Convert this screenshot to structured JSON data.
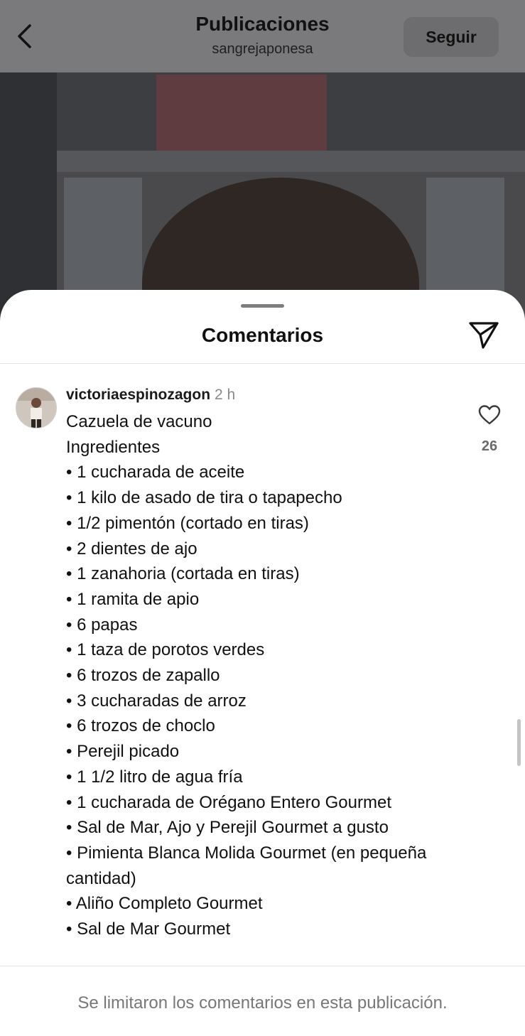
{
  "header": {
    "title": "Publicaciones",
    "username": "sangrejaponesa",
    "follow_label": "Seguir",
    "back_icon": "chevron-left-icon"
  },
  "sheet": {
    "title": "Comentarios",
    "share_icon": "paper-plane-icon"
  },
  "comment": {
    "author": "victoriaespinozagon",
    "time": "2 h",
    "likes": "26",
    "lines": [
      "Cazuela de vacuno",
      "Ingredientes",
      "• 1 cucharada de aceite",
      "• 1 kilo de asado de tira o tapapecho",
      "• 1/2 pimentón (cortado en tiras)",
      "• 2 dientes de ajo",
      "• 1 zanahoria (cortada en tiras)",
      "• 1 ramita de apio",
      "• 6 papas",
      "• 1 taza de porotos verdes",
      "• 6 trozos de zapallo",
      "• 3 cucharadas de arroz",
      "• 6 trozos de choclo",
      "• Perejil picado",
      "• 1 1/2 litro de agua fría",
      "• 1 cucharada de Orégano Entero Gourmet",
      "• Sal de Mar, Ajo y Perejil Gourmet a gusto",
      "• Pimienta Blanca Molida Gourmet (en pequeña",
      "cantidad)",
      "• Aliño Completo Gourmet",
      "• Sal de Mar Gourmet"
    ]
  },
  "footer": {
    "notice": "Se limitaron los comentarios en esta publicación."
  }
}
